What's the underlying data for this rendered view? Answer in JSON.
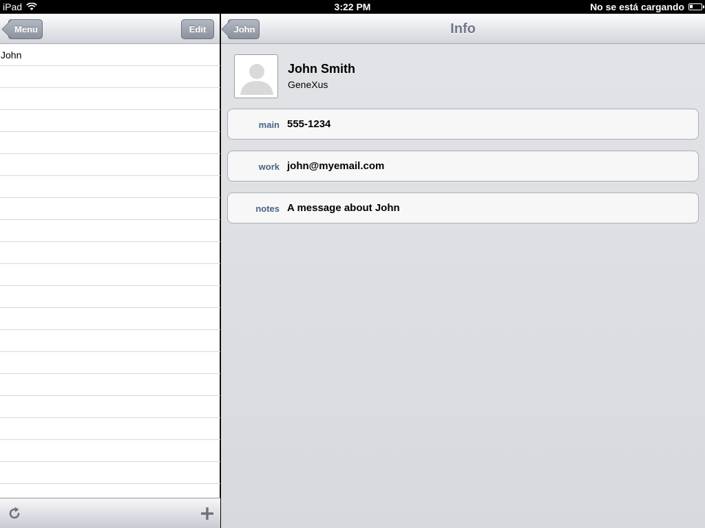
{
  "status_bar": {
    "device": "iPad",
    "time": "3:22 PM",
    "battery_text": "No se está cargando"
  },
  "master": {
    "menu_button": "Menu",
    "edit_button": "Edit",
    "items": [
      "John"
    ],
    "empty_rows": 20,
    "toolbar": {
      "refresh_icon": "refresh-icon",
      "add_icon": "plus-icon"
    }
  },
  "detail": {
    "back_button": "John",
    "title": "Info",
    "contact": {
      "name": "John Smith",
      "company": "GeneXus"
    },
    "fields": [
      {
        "label": "main",
        "value": "555-1234"
      },
      {
        "label": "work",
        "value": "john@myemail.com"
      },
      {
        "label": "notes",
        "value": "A message about John"
      }
    ]
  },
  "colors": {
    "label": "#4b6288",
    "title": "#71788a",
    "nav_button": "#8a929e"
  }
}
